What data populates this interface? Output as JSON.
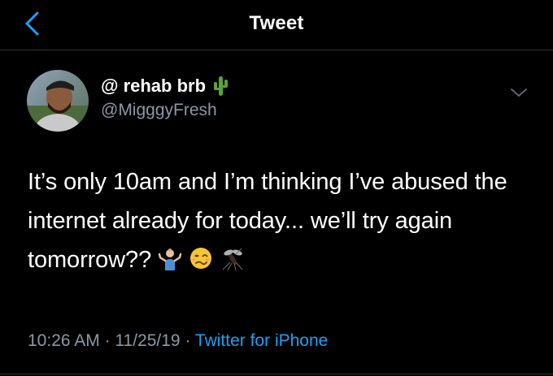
{
  "header": {
    "title": "Tweet",
    "back_icon": "chevron-left-icon"
  },
  "author": {
    "display_name": "@ rehab brb",
    "name_emoji": "cactus",
    "handle": "@MigggyFresh"
  },
  "tweet": {
    "text": "It’s only 10am and I’m thinking I’ve abused the internet already for today... we’ll try again tomorrow??",
    "emojis": [
      "person-shrugging",
      "woozy-face",
      "mosquito"
    ]
  },
  "meta": {
    "time": "10:26 AM",
    "date": "11/25/19",
    "separator": "·",
    "source": "Twitter for iPhone"
  },
  "colors": {
    "background": "#000000",
    "accent": "#1da1f2",
    "secondary_text": "#8b98a5",
    "divider": "#2f3336"
  }
}
